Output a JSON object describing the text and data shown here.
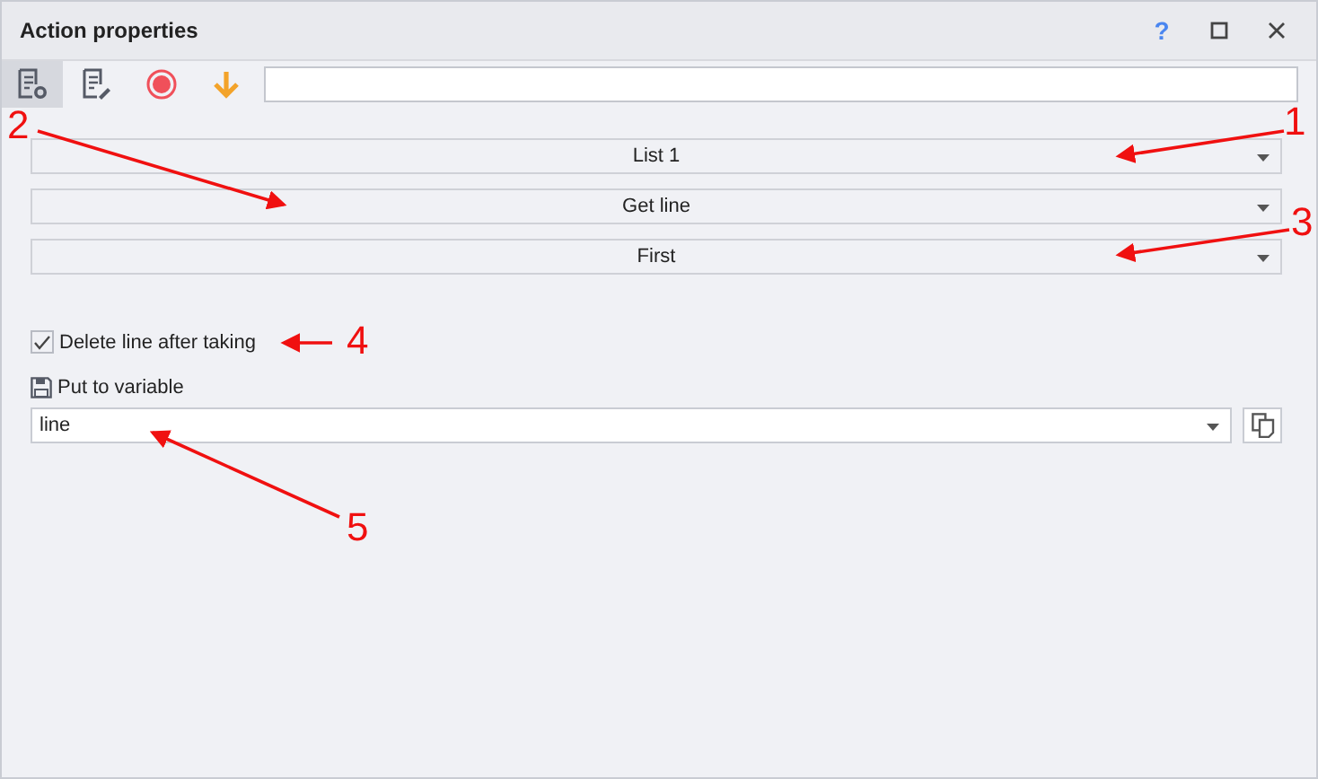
{
  "window": {
    "title": "Action properties",
    "help": "?"
  },
  "toolbar": {
    "buttons": [
      {
        "kind": "settings",
        "selected": true
      },
      {
        "kind": "edit",
        "selected": false
      },
      {
        "kind": "record",
        "selected": false
      },
      {
        "kind": "down",
        "selected": false
      }
    ]
  },
  "dropdowns": [
    {
      "value": "List 1"
    },
    {
      "value": "Get line"
    },
    {
      "value": "First"
    }
  ],
  "delete_checkbox": {
    "label": "Delete line after taking",
    "checked": true
  },
  "variable": {
    "label": "Put to variable",
    "value": "line"
  },
  "annotations": [
    {
      "label": "1"
    },
    {
      "label": "2"
    },
    {
      "label": "3"
    },
    {
      "label": "4"
    },
    {
      "label": "5"
    }
  ]
}
